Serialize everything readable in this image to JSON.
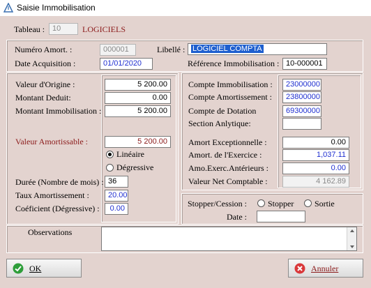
{
  "window": {
    "title": "Saisie Immobilisation"
  },
  "header": {
    "tableau_label": "Tableau :",
    "tableau_value": "10",
    "tableau_name": "LOGICIELS"
  },
  "ident": {
    "numero_label": "Numéro Amort. :",
    "numero_value": "000001",
    "libelle_label": "Libellé :",
    "libelle_value": "LOGICIEL COMPTA",
    "date_label": "Date Acquisition :",
    "date_value": "01/01/2020",
    "reference_label": "Référence Immobilisation :",
    "reference_value": "10-000001"
  },
  "values": {
    "origine_label": "Valeur d'Origine :",
    "origine_value": "5 200.00",
    "deduit_label": "Montant Deduit:",
    "deduit_value": "0.00",
    "immob_label": "Montant Immobilisation :",
    "immob_value": "5 200.00",
    "amortissable_label": "Valeur Amortissable :",
    "amortissable_value": "5 200.00",
    "lineaire_label": "Linéaire",
    "degressive_label": "Dégressive",
    "duree_label": "Durée  (Nombre de mois) :",
    "duree_value": "36",
    "taux_label": "Taux Amortissement :",
    "taux_value": "20.00",
    "coef_label": "Coéficient (Dégressive) :",
    "coef_value": "0.00"
  },
  "accounts": {
    "immob_label": "Compte Immobilisation :",
    "immob_value": "23000000",
    "amort_label": "Compte Amortissement :",
    "amort_value": "23800000",
    "dotation_label": "Compte de Dotation",
    "dotation_value": "69300000",
    "section_label": "Section Anlytique:",
    "section_value": "",
    "except_label": "Amort Exceptionnelle :",
    "except_value": "0.00",
    "exercice_label": "Amort. de l'Exercice :",
    "exercice_value": "1,037.11",
    "anterieurs_label": "Amo.Exerc.Antérieurs :",
    "anterieurs_value": "0.00",
    "vnc_label": "Valeur Net Comptable :",
    "vnc_value": "4 162.89"
  },
  "cession": {
    "label": "Stopper/Cession :",
    "stopper_label": "Stopper",
    "sortie_label": "Sortie",
    "date_label": "Date  :",
    "date_value": ""
  },
  "observations": {
    "label": "Observations"
  },
  "buttons": {
    "ok_label": "OK",
    "annuler_label": "Annuler"
  },
  "icons": {
    "app": "app-icon",
    "ok": "check-icon",
    "annuler": "cancel-icon"
  },
  "colors": {
    "field_blue": "#1f2fd0",
    "label_red": "#8b1a1a",
    "selection": "#1e5fcf"
  }
}
